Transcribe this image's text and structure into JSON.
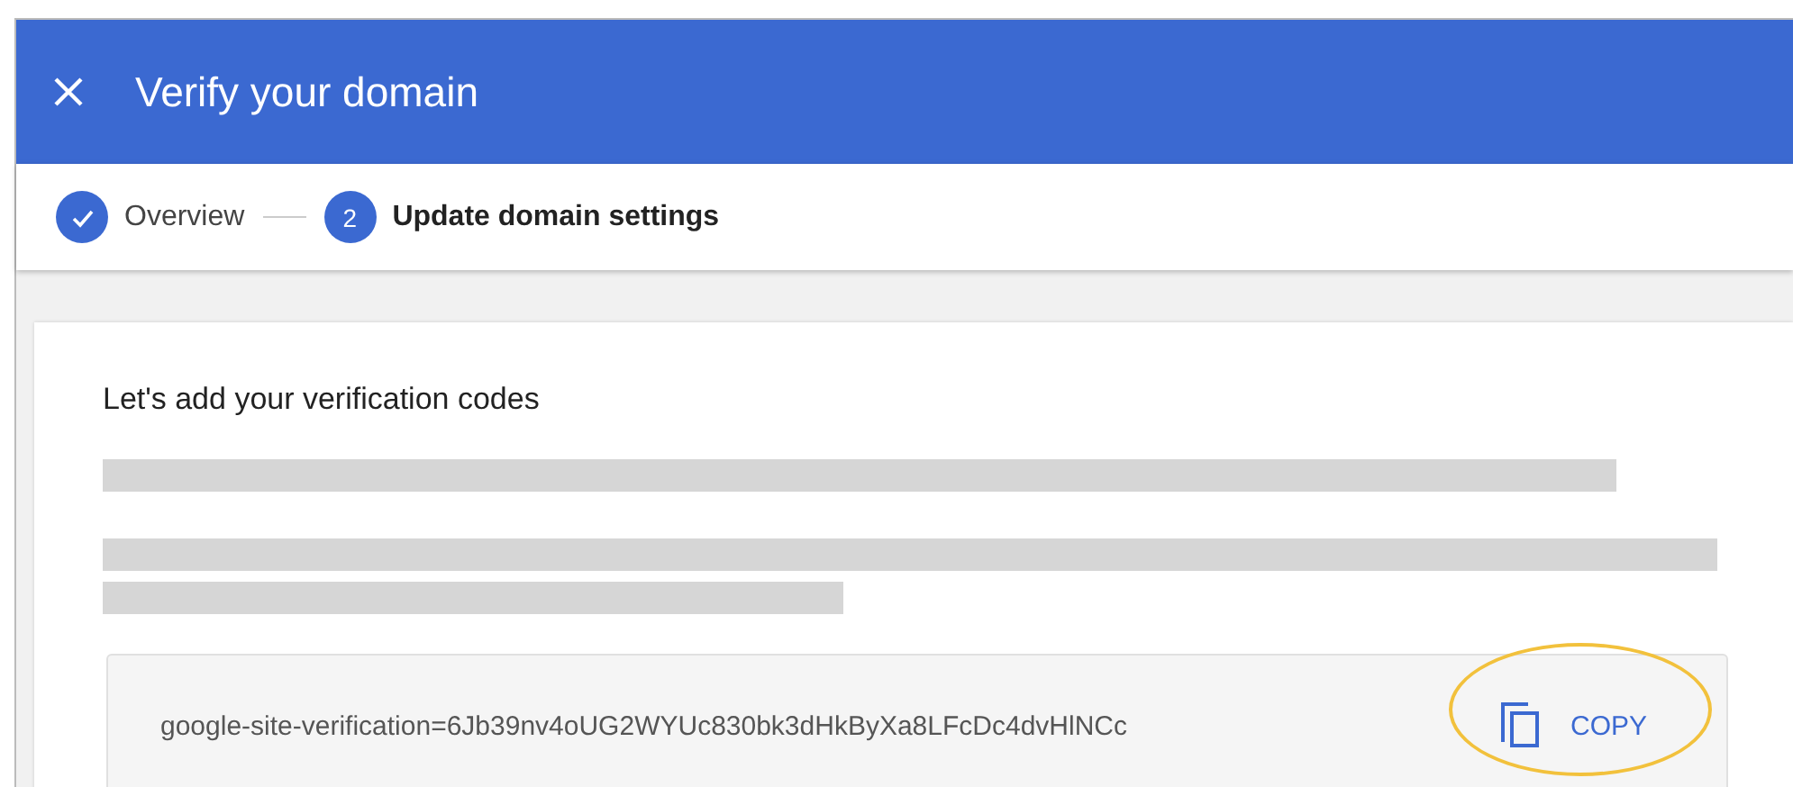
{
  "dialog": {
    "title": "Verify your domain"
  },
  "steps": [
    {
      "kind": "done",
      "label": "Overview",
      "selected": false
    },
    {
      "kind": "number",
      "number": "2",
      "label": "Update domain settings",
      "selected": true
    }
  ],
  "card": {
    "heading": "Let's add your verification codes",
    "code": "google-site-verification=6Jb39nv4oUG2WYUc830bk3dHkByXa8LFcDc4dvHlNCc",
    "copy_label": "COPY"
  }
}
